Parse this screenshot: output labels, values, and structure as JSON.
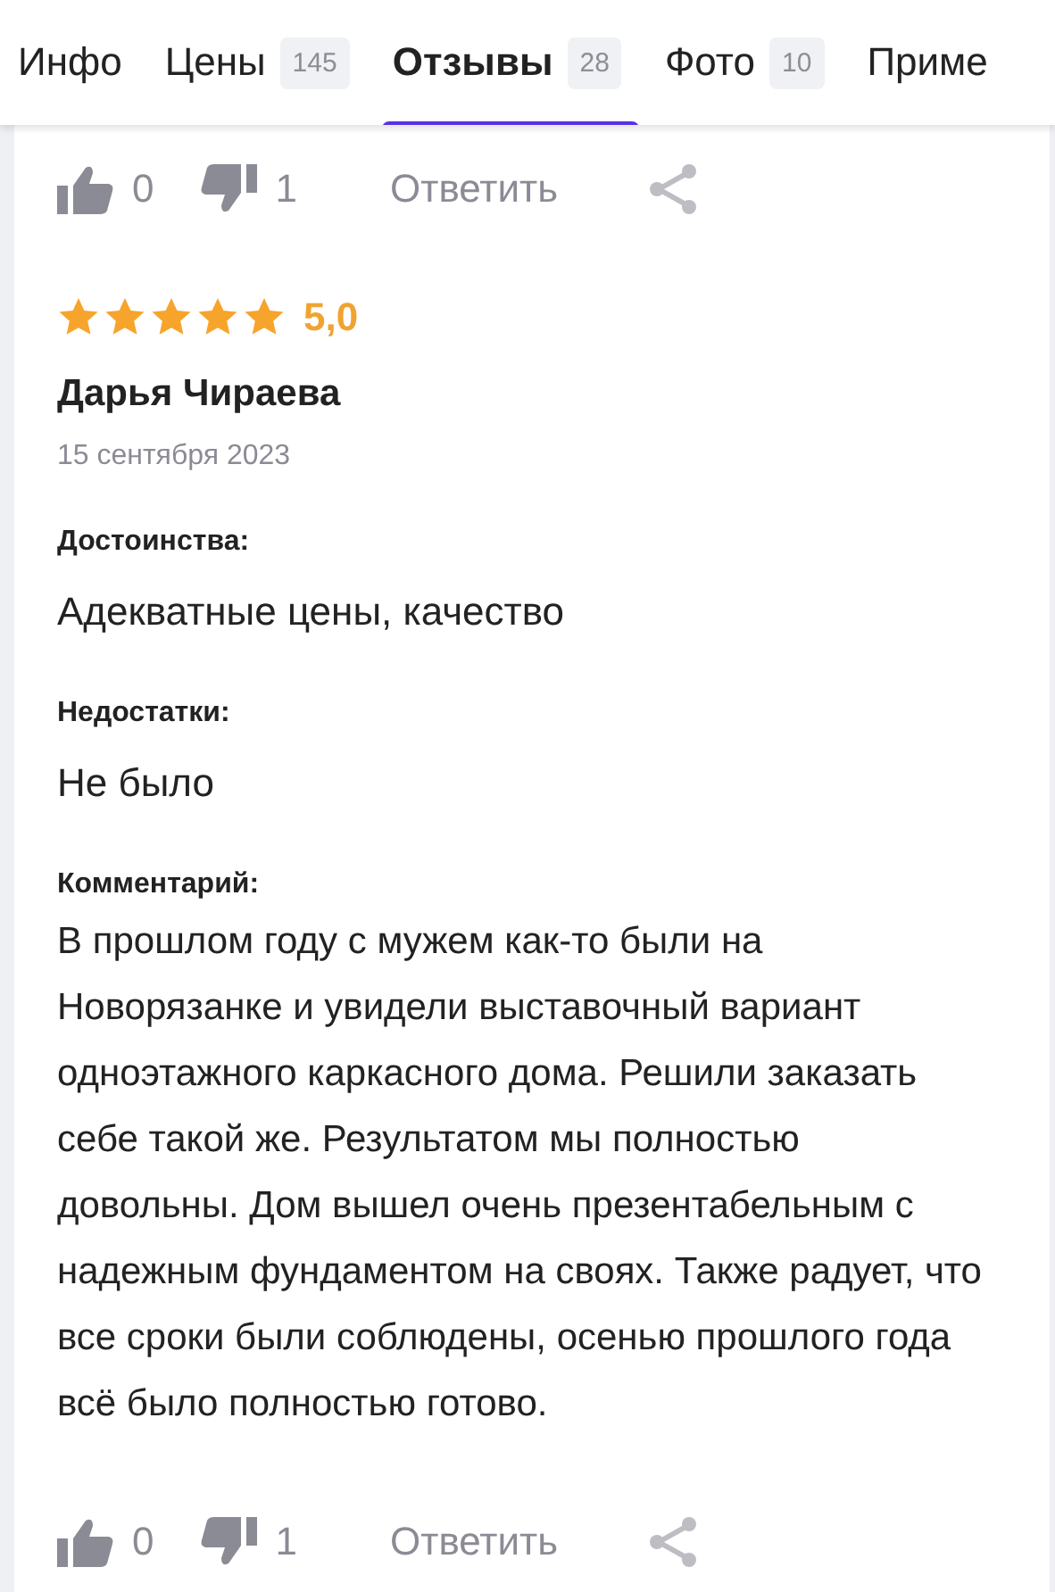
{
  "tabs": [
    {
      "label": "Инфо",
      "selected": false
    },
    {
      "label": "Цены",
      "count": "145",
      "selected": false
    },
    {
      "label": "Отзывы",
      "count": "28",
      "selected": true
    },
    {
      "label": "Фото",
      "count": "10",
      "selected": false
    },
    {
      "label": "Приме",
      "selected": false
    }
  ],
  "previous_review_actions": {
    "likes": "0",
    "dislikes": "1",
    "reply": "Ответить"
  },
  "review": {
    "stars": 5,
    "rating": "5,0",
    "author": "Дарья Чираева",
    "date": "15 сентября 2023",
    "sections": [
      {
        "label": "Достоинства:",
        "text": "Адекватные цены, качество"
      },
      {
        "label": "Недостатки:",
        "text": "Не было"
      },
      {
        "label": "Комментарий:",
        "text": "В прошлом году с мужем как-то были на Новорязанке и увидели выставочный вариант одноэтажного каркасного дома. Решили заказать себе такой же. Результатом мы полностью довольны. Дом вышел очень презентабельным с надежным фундаментом на своях. Также радует, что все сроки были соблюдены, осенью прошлого года всё было полностью готово."
      }
    ],
    "actions": {
      "likes": "0",
      "dislikes": "1",
      "reply": "Ответить"
    }
  }
}
